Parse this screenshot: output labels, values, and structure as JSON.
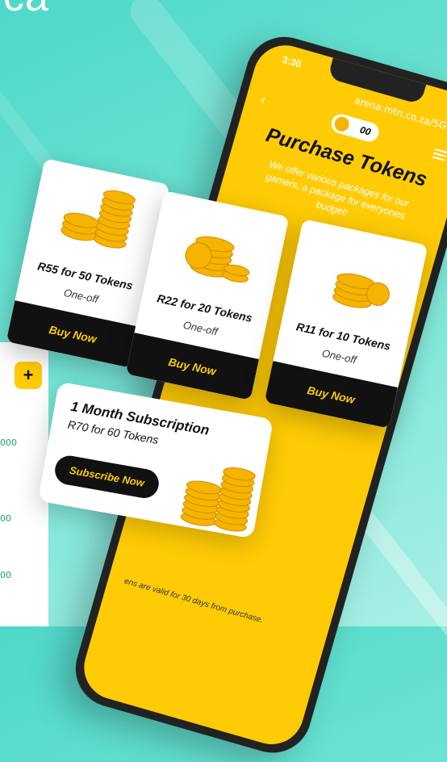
{
  "header": {
    "corner_text": "ca"
  },
  "phone": {
    "time": "3:30",
    "url": "arena.mtn.co.za/5G",
    "token_balance": "00",
    "title": "Purchase Tokens",
    "subtitle": "We offer various packages for our gamers, a package for everyones budget!",
    "footnote": "ens are valid for 30 days from purchase."
  },
  "packages": [
    {
      "title": "R55 for 50 Tokens",
      "type": "One-off",
      "button": "Buy Now"
    },
    {
      "title": "R22 for 20 Tokens",
      "type": "One-off",
      "button": "Buy Now"
    },
    {
      "title": "R11 for 10 Tokens",
      "type": "One-off",
      "button": "Buy Now"
    }
  ],
  "subscription": {
    "title": "1 Month Subscription",
    "price": "R70 for 60 Tokens",
    "button": "Subscribe Now"
  },
  "left_panel": {
    "values": [
      "000",
      "00",
      "00"
    ]
  },
  "colors": {
    "brand_yellow": "#ffcb05",
    "dark": "#111111",
    "teal_bg": "#4fd8c8"
  }
}
